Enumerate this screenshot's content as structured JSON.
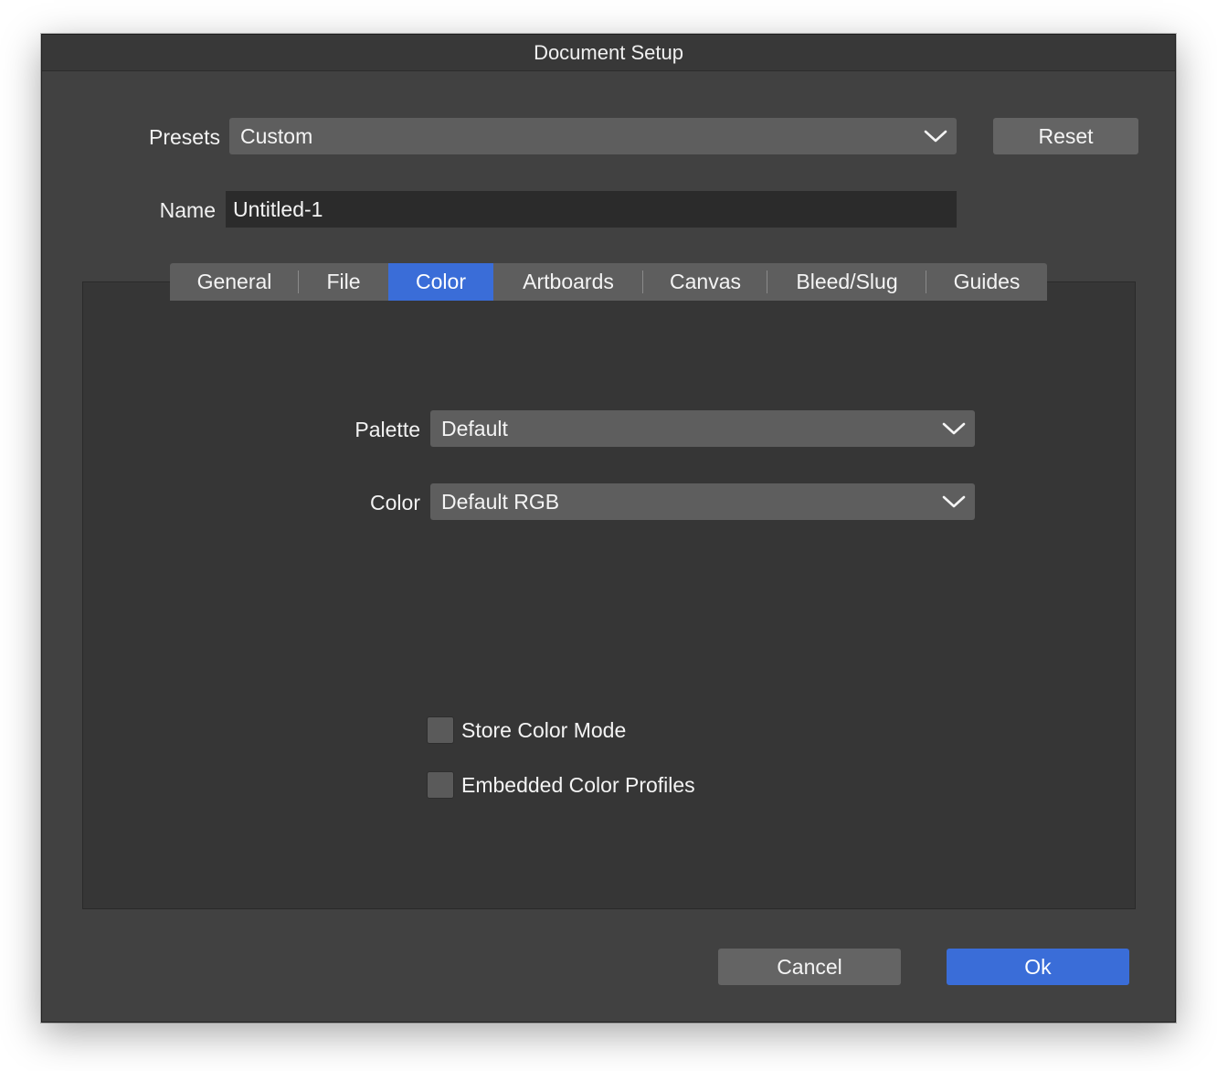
{
  "window": {
    "title": "Document Setup"
  },
  "presets": {
    "label": "Presets",
    "value": "Custom",
    "reset_label": "Reset"
  },
  "name": {
    "label": "Name",
    "value": "Untitled-1"
  },
  "tabs": [
    {
      "label": "General",
      "active": false
    },
    {
      "label": "File",
      "active": false
    },
    {
      "label": "Color",
      "active": true
    },
    {
      "label": "Artboards",
      "active": false
    },
    {
      "label": "Canvas",
      "active": false
    },
    {
      "label": "Bleed/Slug",
      "active": false
    },
    {
      "label": "Guides",
      "active": false
    }
  ],
  "color_tab": {
    "palette": {
      "label": "Palette",
      "value": "Default"
    },
    "color": {
      "label": "Color",
      "value": "Default RGB"
    },
    "store_color_mode": {
      "label": "Store Color Mode",
      "checked": false
    },
    "embedded_profiles": {
      "label": "Embedded Color Profiles",
      "checked": false
    }
  },
  "footer": {
    "cancel_label": "Cancel",
    "ok_label": "Ok"
  },
  "colors": {
    "window_bg": "#414141",
    "panel_bg": "#363636",
    "control_bg": "#5e5e5e",
    "accent": "#3a6dd8"
  },
  "icons": {
    "dropdown": "chevron-down-icon"
  }
}
